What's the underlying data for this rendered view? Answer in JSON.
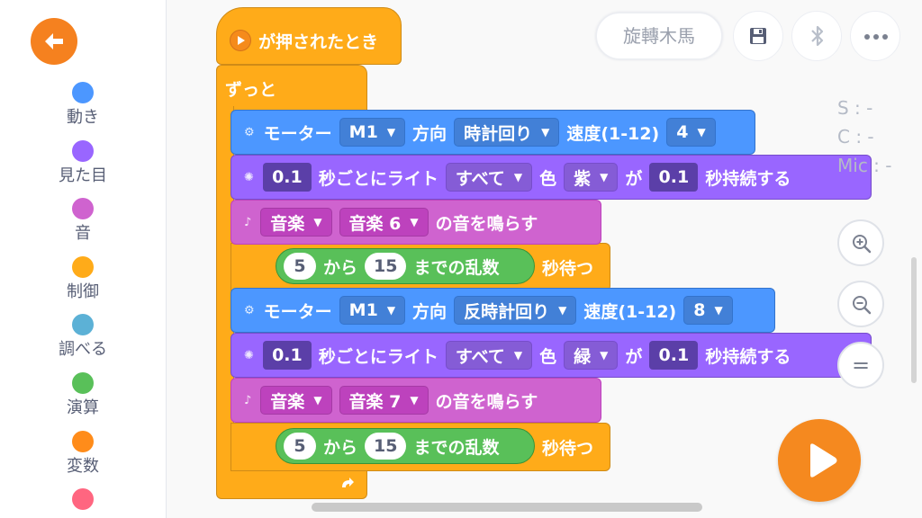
{
  "sidebar": {
    "categories": [
      {
        "label": "動き",
        "color": "#4c97ff"
      },
      {
        "label": "見た目",
        "color": "#9966ff"
      },
      {
        "label": "音",
        "color": "#cf63cf"
      },
      {
        "label": "制御",
        "color": "#ffab19"
      },
      {
        "label": "調べる",
        "color": "#5cb1d6"
      },
      {
        "label": "演算",
        "color": "#59c059"
      },
      {
        "label": "変数",
        "color": "#ff8c1a"
      },
      {
        "label": "",
        "color": "#ff6680"
      }
    ]
  },
  "header": {
    "project_title": "旋轉木馬",
    "save_icon": "save-icon",
    "bluetooth_icon": "bluetooth-icon",
    "more_icon": "more-icon"
  },
  "status": {
    "s": "S : -",
    "c": "C : -",
    "mic": "Mic : -"
  },
  "zoom": {
    "reset_label": "="
  },
  "script": {
    "hat": "が押されたとき",
    "forever": "ずっと",
    "motor1": {
      "label": "モーター",
      "port": "M1",
      "dir_label": "方向",
      "dir": "時計回り",
      "speed_label": "速度(1-12)",
      "speed": "4"
    },
    "light1": {
      "interval": "0.1",
      "label": "秒ごとにライト",
      "target": "すべて",
      "color_label": "色",
      "color": "紫",
      "ga": "が",
      "duration": "0.1",
      "end": "秒持続する"
    },
    "sound1": {
      "category": "音楽",
      "sound": "音楽 6",
      "end": "の音を鳴らす"
    },
    "wait1": {
      "from": "5",
      "kara": "から",
      "to": "15",
      "rand": "までの乱数",
      "end": "秒待つ"
    },
    "motor2": {
      "label": "モーター",
      "port": "M1",
      "dir_label": "方向",
      "dir": "反時計回り",
      "speed_label": "速度(1-12)",
      "speed": "8"
    },
    "light2": {
      "interval": "0.1",
      "label": "秒ごとにライト",
      "target": "すべて",
      "color_label": "色",
      "color": "緑",
      "ga": "が",
      "duration": "0.1",
      "end": "秒持続する"
    },
    "sound2": {
      "category": "音楽",
      "sound": "音楽 7",
      "end": "の音を鳴らす"
    },
    "wait2": {
      "from": "5",
      "kara": "から",
      "to": "15",
      "rand": "までの乱数",
      "end": "秒待つ"
    }
  }
}
